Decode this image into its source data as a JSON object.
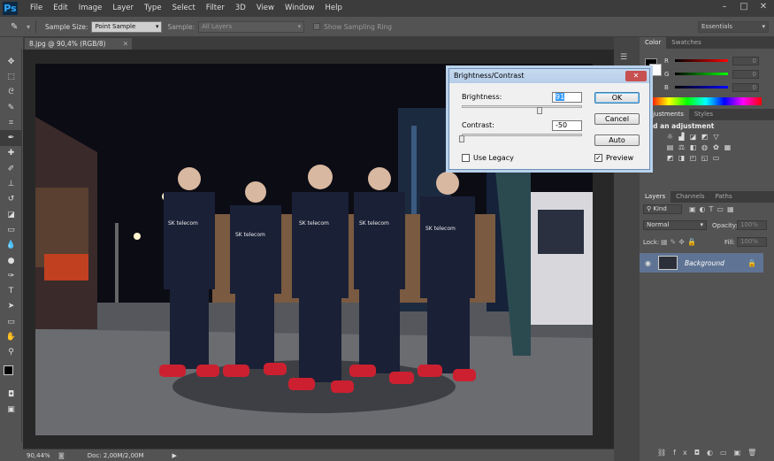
{
  "app": {
    "logo": "Ps"
  },
  "menu": [
    "File",
    "Edit",
    "Image",
    "Layer",
    "Type",
    "Select",
    "Filter",
    "3D",
    "View",
    "Window",
    "Help"
  ],
  "window_controls": {
    "minimize": "–",
    "maximize": "□",
    "close": "✕"
  },
  "options_bar": {
    "sample_size_label": "Sample Size:",
    "sample_size_value": "Point Sample",
    "sample_label": "Sample:",
    "sample_value": "All Layers",
    "show_ring_label": "Show Sampling Ring",
    "workspace": "Essentials"
  },
  "document": {
    "tab_title": "8.jpg @ 90,4% (RGB/8)",
    "tab_close": "✕"
  },
  "status": {
    "zoom": "90,44%",
    "doc": "Doc: 2,00M/2,00M"
  },
  "tools": [
    "move-icon",
    "marquee-icon",
    "lasso-icon",
    "quick-select-icon",
    "crop-icon",
    "eyedropper-icon",
    "healing-icon",
    "brush-icon",
    "stamp-icon",
    "history-brush-icon",
    "eraser-icon",
    "gradient-icon",
    "blur-icon",
    "dodge-icon",
    "pen-icon",
    "type-icon",
    "path-select-icon",
    "shape-icon",
    "hand-icon",
    "zoom-icon"
  ],
  "color_panel": {
    "tabs": [
      "Color",
      "Swatches"
    ],
    "channels": [
      {
        "label": "R",
        "value": "0"
      },
      {
        "label": "G",
        "value": "0"
      },
      {
        "label": "B",
        "value": "0"
      }
    ]
  },
  "adjustments_panel": {
    "tabs": [
      "Adjustments",
      "Styles"
    ],
    "title": "Add an adjustment"
  },
  "layers_panel": {
    "tabs": [
      "Layers",
      "Channels",
      "Paths"
    ],
    "filter_kind": "Kind",
    "blend_mode": "Normal",
    "opacity_label": "Opacity:",
    "opacity_value": "100%",
    "lock_label": "Lock:",
    "fill_label": "Fill:",
    "fill_value": "100%",
    "layer_name": "Background"
  },
  "photo": {
    "jersey_text": "SK telecom"
  },
  "dialog": {
    "title": "Brightness/Contrast",
    "close": "✕",
    "brightness_label": "Brightness:",
    "brightness_value": "91",
    "contrast_label": "Contrast:",
    "contrast_value": "-50",
    "use_legacy_label": "Use Legacy",
    "use_legacy_checked": false,
    "preview_label": "Preview",
    "preview_checked": true,
    "ok_label": "OK",
    "cancel_label": "Cancel",
    "auto_label": "Auto",
    "brightness_slider_fraction": 0.65,
    "contrast_slider_fraction": 0.0
  }
}
